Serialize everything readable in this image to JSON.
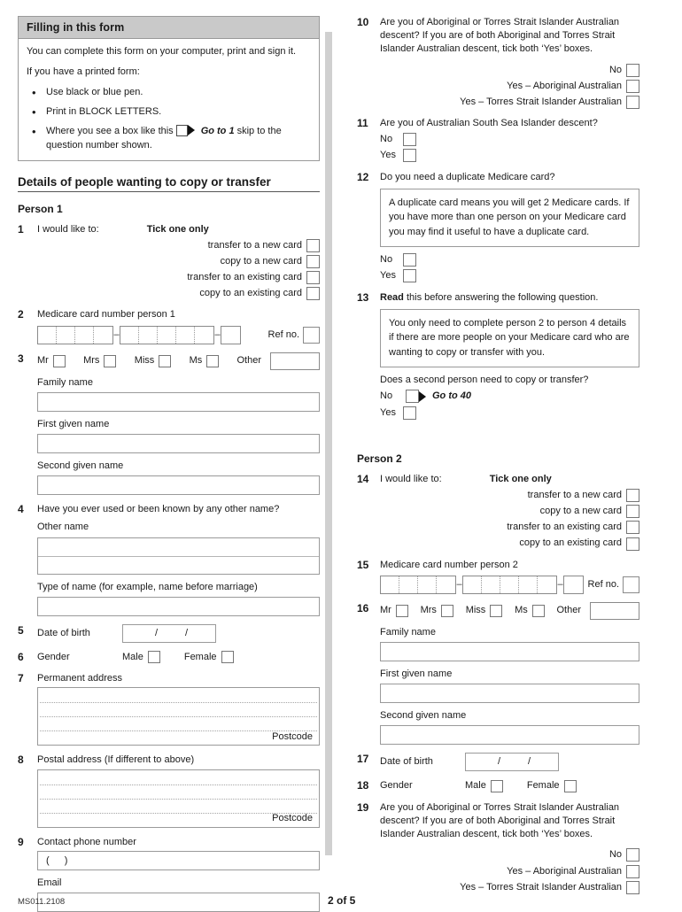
{
  "info_box": {
    "title": "Filling in this form",
    "intro": "You can complete this form on your computer, print and sign it.",
    "printed_lead": "If you have a printed form:",
    "bullets": [
      "Use black or blue pen.",
      "Print in BLOCK LETTERS."
    ],
    "goto_bullet": {
      "before": "Where you see a box like this",
      "goto_label": "Go to 1",
      "after": "skip to the question number shown."
    }
  },
  "section": {
    "heading": "Details of people wanting to copy or transfer",
    "person1": "Person 1",
    "person2": "Person 2"
  },
  "labels": {
    "tick_one_only": "Tick one only",
    "i_would_like_to": "I would like to:",
    "ref_no": "Ref no.",
    "family_name": "Family name",
    "first_given_name": "First given name",
    "second_given_name": "Second given name",
    "other_name": "Other name",
    "type_of_name": "Type of name (for example, name before marriage)",
    "date_of_birth": "Date of birth",
    "gender": "Gender",
    "male": "Male",
    "female": "Female",
    "permanent_address": "Permanent address",
    "postal_address": "Postal address (If different to above)",
    "postcode": "Postcode",
    "contact_phone": "Contact phone number",
    "email": "Email",
    "phone_prefix": "(      )",
    "no": "No",
    "yes": "Yes",
    "slash": "/",
    "dash": "–",
    "mr": "Mr",
    "mrs": "Mrs",
    "miss": "Miss",
    "ms": "Ms",
    "other": "Other"
  },
  "transfer_options": [
    "transfer to a new card",
    "copy to a new card",
    "transfer to an existing card",
    "copy to an existing card"
  ],
  "questions": {
    "q1": {
      "num": "1",
      "text": "I would like to:"
    },
    "q2": {
      "num": "2",
      "text": "Medicare card number person 1"
    },
    "q3": {
      "num": "3"
    },
    "q4": {
      "num": "4",
      "text": "Have you ever used or been known by any other name?"
    },
    "q5": {
      "num": "5",
      "text": "Date of birth"
    },
    "q6": {
      "num": "6",
      "text": "Gender"
    },
    "q7": {
      "num": "7",
      "text": "Permanent address"
    },
    "q8": {
      "num": "8",
      "text": "Postal address (If different to above)"
    },
    "q9": {
      "num": "9",
      "text": "Contact phone number"
    },
    "q10": {
      "num": "10",
      "text": "Are you of Aboriginal or Torres Strait Islander Australian descent? If you are of both Aboriginal and Torres Strait Islander Australian descent, tick both ‘Yes’ boxes.",
      "options": [
        "No",
        "Yes – Aboriginal Australian",
        "Yes – Torres Strait Islander Australian"
      ]
    },
    "q11": {
      "num": "11",
      "text": "Are you of Australian South Sea Islander descent?"
    },
    "q12": {
      "num": "12",
      "text": "Do you need a duplicate Medicare card?",
      "note": "A duplicate card means you will get 2 Medicare cards. If you have more than one person on your Medicare card you may find it useful to have a duplicate card."
    },
    "q13": {
      "num": "13",
      "text_bold": "Read",
      "text_rest": " this before answering the following question.",
      "note": "You only need to complete person 2 to person 4 details if there are more people on your Medicare card who are wanting to copy or transfer with you.",
      "sub_question": "Does a second person need to copy or transfer?",
      "goto_label": "Go to 40"
    },
    "q14": {
      "num": "14",
      "text": "I would like to:"
    },
    "q15": {
      "num": "15",
      "text": "Medicare card number person 2"
    },
    "q16": {
      "num": "16"
    },
    "q17": {
      "num": "17",
      "text": "Date of birth"
    },
    "q18": {
      "num": "18",
      "text": "Gender"
    },
    "q19": {
      "num": "19",
      "text": "Are you of Aboriginal or Torres Strait Islander Australian descent? If you are of both Aboriginal and Torres Strait Islander Australian descent, tick both ‘Yes’ boxes.",
      "options": [
        "No",
        "Yes – Aboriginal Australian",
        "Yes – Torres Strait Islander Australian"
      ]
    }
  },
  "footer": {
    "form_code": "MS011.2108",
    "page": "2 of 5"
  }
}
